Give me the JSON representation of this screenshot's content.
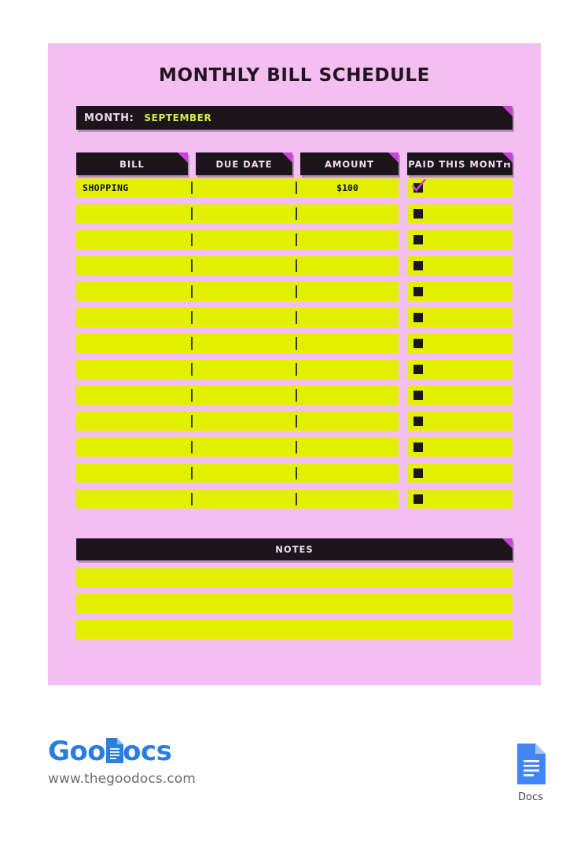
{
  "document": {
    "title": "MONTHLY BILL SCHEDULE"
  },
  "month_field": {
    "label": "MONTH:",
    "value": "SEPTEMBER"
  },
  "table": {
    "columns": [
      {
        "key": "bill",
        "label": "BILL"
      },
      {
        "key": "due",
        "label": "DUE DATE"
      },
      {
        "key": "amount",
        "label": "AMOUNT"
      },
      {
        "key": "paid",
        "label": "PAID THIS MONTH"
      }
    ],
    "rows": [
      {
        "bill": "SHOPPING",
        "due": "",
        "amount": "$100",
        "paid": true
      },
      {
        "bill": "",
        "due": "",
        "amount": "",
        "paid": false
      },
      {
        "bill": "",
        "due": "",
        "amount": "",
        "paid": false
      },
      {
        "bill": "",
        "due": "",
        "amount": "",
        "paid": false
      },
      {
        "bill": "",
        "due": "",
        "amount": "",
        "paid": false
      },
      {
        "bill": "",
        "due": "",
        "amount": "",
        "paid": false
      },
      {
        "bill": "",
        "due": "",
        "amount": "",
        "paid": false
      },
      {
        "bill": "",
        "due": "",
        "amount": "",
        "paid": false
      },
      {
        "bill": "",
        "due": "",
        "amount": "",
        "paid": false
      },
      {
        "bill": "",
        "due": "",
        "amount": "",
        "paid": false
      },
      {
        "bill": "",
        "due": "",
        "amount": "",
        "paid": false
      },
      {
        "bill": "",
        "due": "",
        "amount": "",
        "paid": false
      },
      {
        "bill": "",
        "due": "",
        "amount": "",
        "paid": false
      }
    ]
  },
  "notes": {
    "header": "NOTES",
    "lines": [
      "",
      "",
      ""
    ]
  },
  "footer": {
    "brand_part1": "Goo",
    "brand_part2": "ocs",
    "brand_icon": "document-icon",
    "website": "www.thegoodocs.com",
    "docs_label": "Docs",
    "docs_icon": "google-docs-icon"
  },
  "colors": {
    "sheet_pink": "#f3bff1",
    "row_yellow": "#e2f000",
    "bar_dark": "#1c161c",
    "fold_magenta": "#c743d6",
    "accent_green": "#d8ea3d",
    "brand_blue": "#2a7de1"
  }
}
